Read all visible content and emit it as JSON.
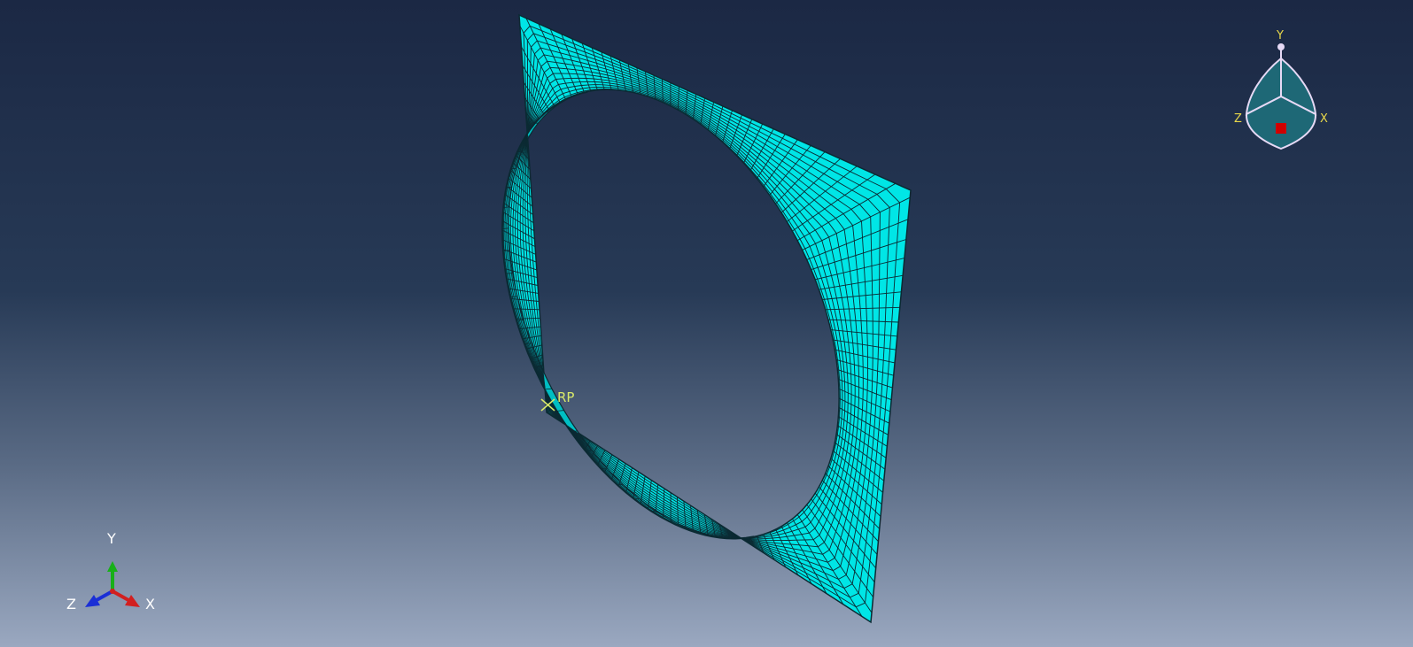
{
  "viewport": {
    "reference_point_label": "RP",
    "triad_labels": {
      "x": "X",
      "y": "Y",
      "z": "Z"
    },
    "view_cube_labels": {
      "x": "X",
      "y": "Y",
      "z": "Z"
    }
  },
  "colors": {
    "mesh_fill": "#00e6e6",
    "mesh_line": "#0b2a33",
    "rp_marker": "#d8e86a",
    "triad_x": "#d21f1f",
    "triad_y": "#18b018",
    "triad_z": "#1a2fd6",
    "view_cube_face": "#1e6876",
    "view_cube_outline": "#e6d9f5",
    "view_cube_center": "#d00000",
    "view_cube_label": "#e8d84a"
  }
}
